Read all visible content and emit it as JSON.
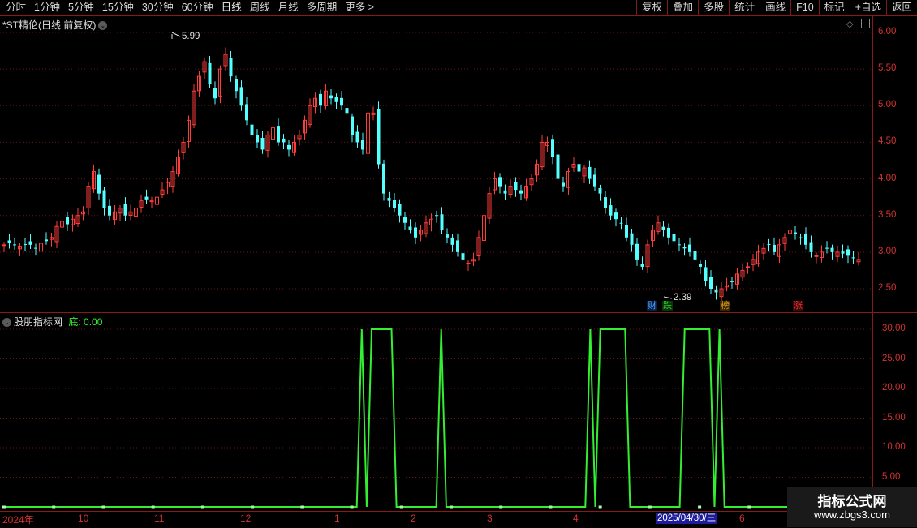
{
  "toolbar": {
    "periods": [
      "分时",
      "1分钟",
      "5分钟",
      "15分钟",
      "30分钟",
      "60分钟",
      "日线",
      "周线",
      "月线",
      "多周期",
      "更多 >"
    ],
    "active_period": "日线",
    "right_buttons": [
      "复权",
      "叠加",
      "多股",
      "统计",
      "画线",
      "F10",
      "标记",
      "+自选",
      "返回"
    ]
  },
  "main_panel": {
    "title": "*ST精伦(日线 前复权)",
    "high_label": "5.99",
    "low_label": "2.39",
    "y_ticks": [
      "6.00",
      "5.50",
      "5.00",
      "4.50",
      "4.00",
      "3.50",
      "3.00",
      "2.50"
    ],
    "tags": [
      {
        "text": "财",
        "color": "#4aa3ff"
      },
      {
        "text": "跌",
        "color": "#22dd22"
      },
      {
        "text": "榜",
        "color": "#e0a020"
      },
      {
        "text": "涨",
        "color": "#ff3030"
      }
    ]
  },
  "indicator_panel": {
    "title": "股朋指标网",
    "series_label": "底:",
    "series_value": "0.00",
    "y_ticks": [
      "30.00",
      "25.00",
      "20.00",
      "15.00",
      "10.00",
      "5.00"
    ]
  },
  "date_axis": {
    "labels": [
      "2024年",
      "10",
      "11",
      "12",
      "1",
      "2",
      "3",
      "4",
      "2025/04/30/三",
      "6"
    ]
  },
  "watermark": {
    "line1": "指标公式网",
    "line2": "www.zbgs3.com"
  },
  "colors": {
    "up": "#ff3c3c",
    "down": "#54ffff",
    "indicator": "#33ee33",
    "axis": "#d23232",
    "grid": "#6a1414"
  },
  "chart_data": [
    {
      "type": "candlestick",
      "title": "*ST精伦(日线 前复权)",
      "ylim": [
        2.3,
        6.1
      ],
      "annotations": [
        {
          "label": "5.99",
          "kind": "high"
        },
        {
          "label": "2.39",
          "kind": "low"
        }
      ],
      "close_approx": [
        3.1,
        3.12,
        3.1,
        3.08,
        3.1,
        3.1,
        3.05,
        3.12,
        3.15,
        3.2,
        3.35,
        3.42,
        3.38,
        3.45,
        3.5,
        3.55,
        3.9,
        4.1,
        3.8,
        3.6,
        3.5,
        3.55,
        3.6,
        3.5,
        3.55,
        3.6,
        3.7,
        3.72,
        3.7,
        3.75,
        3.85,
        3.95,
        4.1,
        4.3,
        4.5,
        4.8,
        5.2,
        5.4,
        5.6,
        5.3,
        5.1,
        5.5,
        5.7,
        5.4,
        5.2,
        5.0,
        4.8,
        4.6,
        4.5,
        4.4,
        4.6,
        4.7,
        4.5,
        4.5,
        4.4,
        4.5,
        4.6,
        4.8,
        5.0,
        5.1,
        5.0,
        5.2,
        5.1,
        5.05,
        5.0,
        4.9,
        4.6,
        4.5,
        4.4,
        4.9,
        4.9,
        4.2,
        3.8,
        3.7,
        3.6,
        3.5,
        3.4,
        3.3,
        3.2,
        3.3,
        3.4,
        3.45,
        3.5,
        3.3,
        3.2,
        3.1,
        3.0,
        2.9,
        2.85,
        2.9,
        3.2,
        3.5,
        3.8,
        4.0,
        3.9,
        3.8,
        3.9,
        3.85,
        3.8,
        3.9,
        4.0,
        4.2,
        4.5,
        4.5,
        4.3,
        4.0,
        3.9,
        4.1,
        4.2,
        4.1,
        4.15,
        4.0,
        3.9,
        3.8,
        3.6,
        3.5,
        3.45,
        3.4,
        3.2,
        3.1,
        2.9,
        2.8,
        3.1,
        3.3,
        3.4,
        3.3,
        3.2,
        3.15,
        3.1,
        3.05,
        3.0,
        2.9,
        2.8,
        2.6,
        2.5,
        2.45,
        2.5,
        2.55,
        2.6,
        2.7,
        2.75,
        2.8,
        2.9,
        3.0,
        3.05,
        3.1,
        3.0,
        3.1,
        3.2,
        3.3,
        3.25,
        3.2,
        3.1,
        3.0,
        2.95,
        3.0,
        3.05,
        3.0,
        3.0,
        2.98,
        2.95,
        2.92,
        2.9
      ]
    },
    {
      "type": "line",
      "title": "股朋指标网",
      "series": [
        {
          "name": "底",
          "values": [
            0,
            0,
            0,
            0,
            0,
            0,
            0,
            0,
            0,
            0,
            0,
            0,
            0,
            0,
            0,
            0,
            0,
            0,
            0,
            0,
            0,
            0,
            0,
            0,
            0,
            0,
            0,
            0,
            0,
            0,
            0,
            0,
            0,
            0,
            0,
            0,
            0,
            0,
            0,
            0,
            0,
            0,
            0,
            0,
            0,
            0,
            0,
            0,
            0,
            0,
            0,
            0,
            0,
            0,
            0,
            0,
            0,
            0,
            0,
            0,
            0,
            0,
            0,
            0,
            0,
            0,
            0,
            0,
            0,
            0,
            0,
            0,
            30,
            0,
            30,
            30,
            30,
            30,
            30,
            0,
            0,
            0,
            0,
            0,
            0,
            0,
            0,
            0,
            30,
            0,
            0,
            0,
            0,
            0,
            0,
            0,
            0,
            0,
            0,
            0,
            0,
            0,
            0,
            0,
            0,
            0,
            0,
            0,
            0,
            0,
            0,
            0,
            0,
            0,
            0,
            0,
            0,
            0,
            30,
            0,
            30,
            30,
            30,
            30,
            30,
            30,
            0,
            0,
            0,
            0,
            0,
            0,
            0,
            0,
            0,
            0,
            0,
            30,
            30,
            30,
            30,
            30,
            30,
            0,
            30,
            0,
            0,
            0,
            0,
            0,
            0,
            0,
            0,
            0,
            0,
            0,
            0,
            0,
            0,
            0,
            0,
            0,
            0,
            0,
            0,
            0,
            0,
            0,
            0,
            0,
            0,
            0,
            0
          ]
        }
      ],
      "ylim": [
        0,
        31
      ]
    }
  ]
}
